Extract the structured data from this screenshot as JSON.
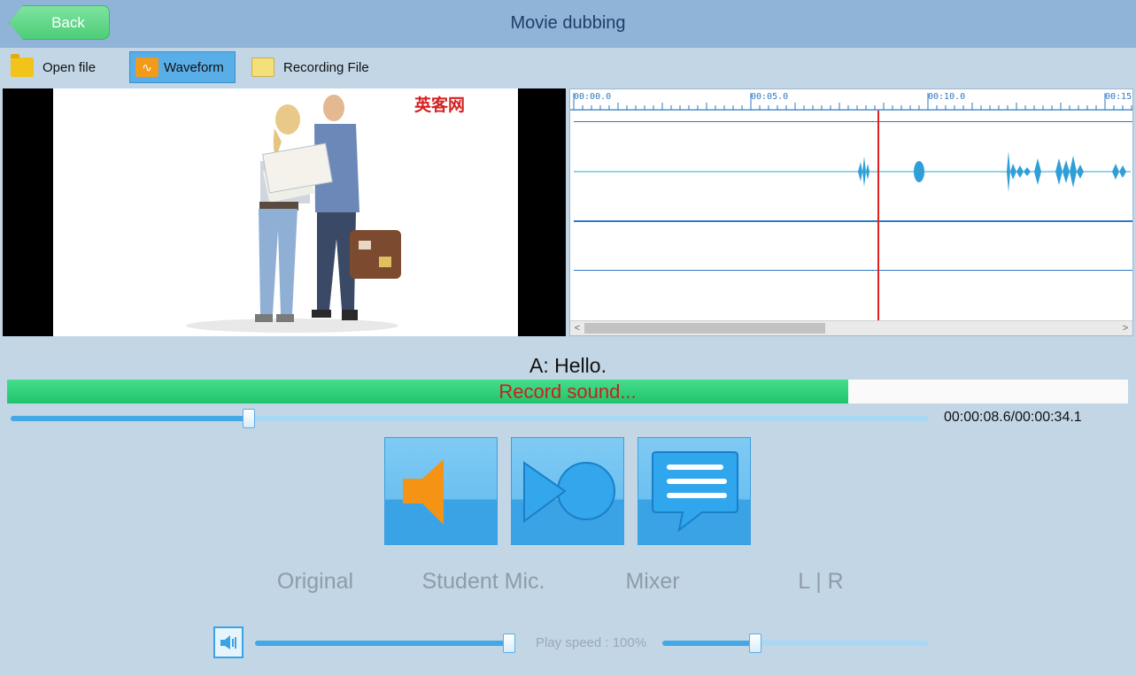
{
  "window": {
    "title": "Movie dubbing",
    "back_label": "Back"
  },
  "toolbar": {
    "open_file": "Open file",
    "waveform": "Waveform",
    "recording_file": "Recording File"
  },
  "video": {
    "watermark": "英客网"
  },
  "waveform": {
    "ticks": [
      "00:00.0",
      "00:05.0",
      "00:10.0",
      "00:15"
    ]
  },
  "subtitle": "A: Hello.",
  "record": {
    "text": "Record sound...",
    "progress": 0.75
  },
  "playback": {
    "position_fraction": 0.26,
    "time": "00:00:08.6/00:00:34.1"
  },
  "modes": {
    "original": "Original",
    "student_mic": "Student Mic.",
    "mixer": "Mixer",
    "lr": "L | R"
  },
  "bottom": {
    "volume_fraction": 1.0,
    "speed_label": "Play speed : 100%",
    "speed_fraction": 0.35
  },
  "colors": {
    "accent": "#3aa3e6",
    "record_fill": "#2fd27a",
    "record_text": "#c8211b",
    "playhead": "#e02020"
  }
}
